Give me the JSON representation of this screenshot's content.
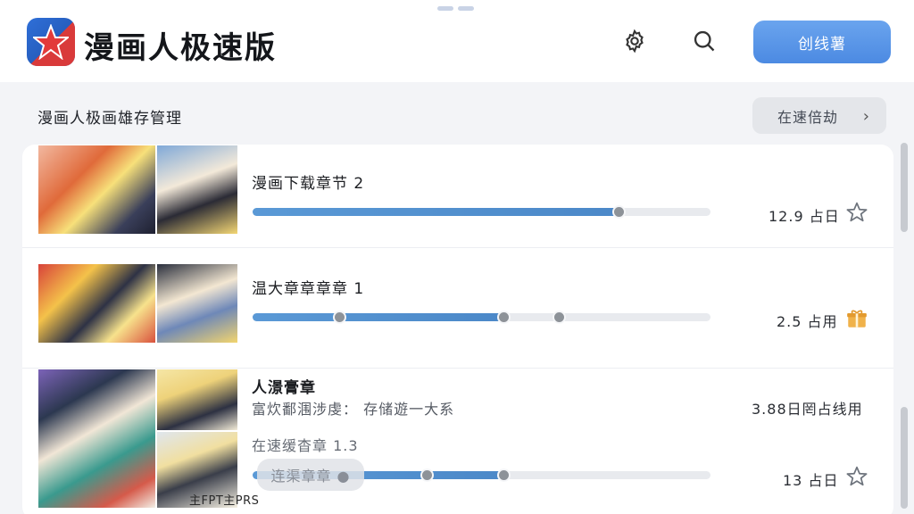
{
  "header": {
    "app_title": "漫画人极速版",
    "create_button": "创线薯",
    "logo_icon": "star-logo-icon",
    "icons": [
      "gear-icon",
      "search-icon"
    ]
  },
  "section": {
    "title": "漫画人极画雄存管理",
    "action_label": "在速倍劫"
  },
  "rows": [
    {
      "title": "漫画下载章节 2",
      "progress": 0.81,
      "meta": "12.9 占日",
      "action_icon": "star-outline-icon"
    },
    {
      "title": "温大章章章章 1",
      "progress": 0.55,
      "markers": [
        0.19,
        0.55,
        0.67
      ],
      "meta": "2.5 占用",
      "action_icon": "gift-icon"
    },
    {
      "title": "人澋膏章",
      "subtitle": "富炊鄱涠涉虔： 存储遊一大系",
      "meta_top": "3.88日罔占线用",
      "subtitle2": "在速缓杳章 1.3",
      "progress": 0.55,
      "markers": [
        0.38,
        0.55
      ],
      "meta": "13 占日",
      "action_icon": "star-outline-icon"
    }
  ],
  "toast": "连渠章章 ●",
  "credit": "主FPT主PRS",
  "colors": {
    "accent": "#4c8ae2",
    "progress": "#4b88c8",
    "gift": "#e8a23a"
  }
}
